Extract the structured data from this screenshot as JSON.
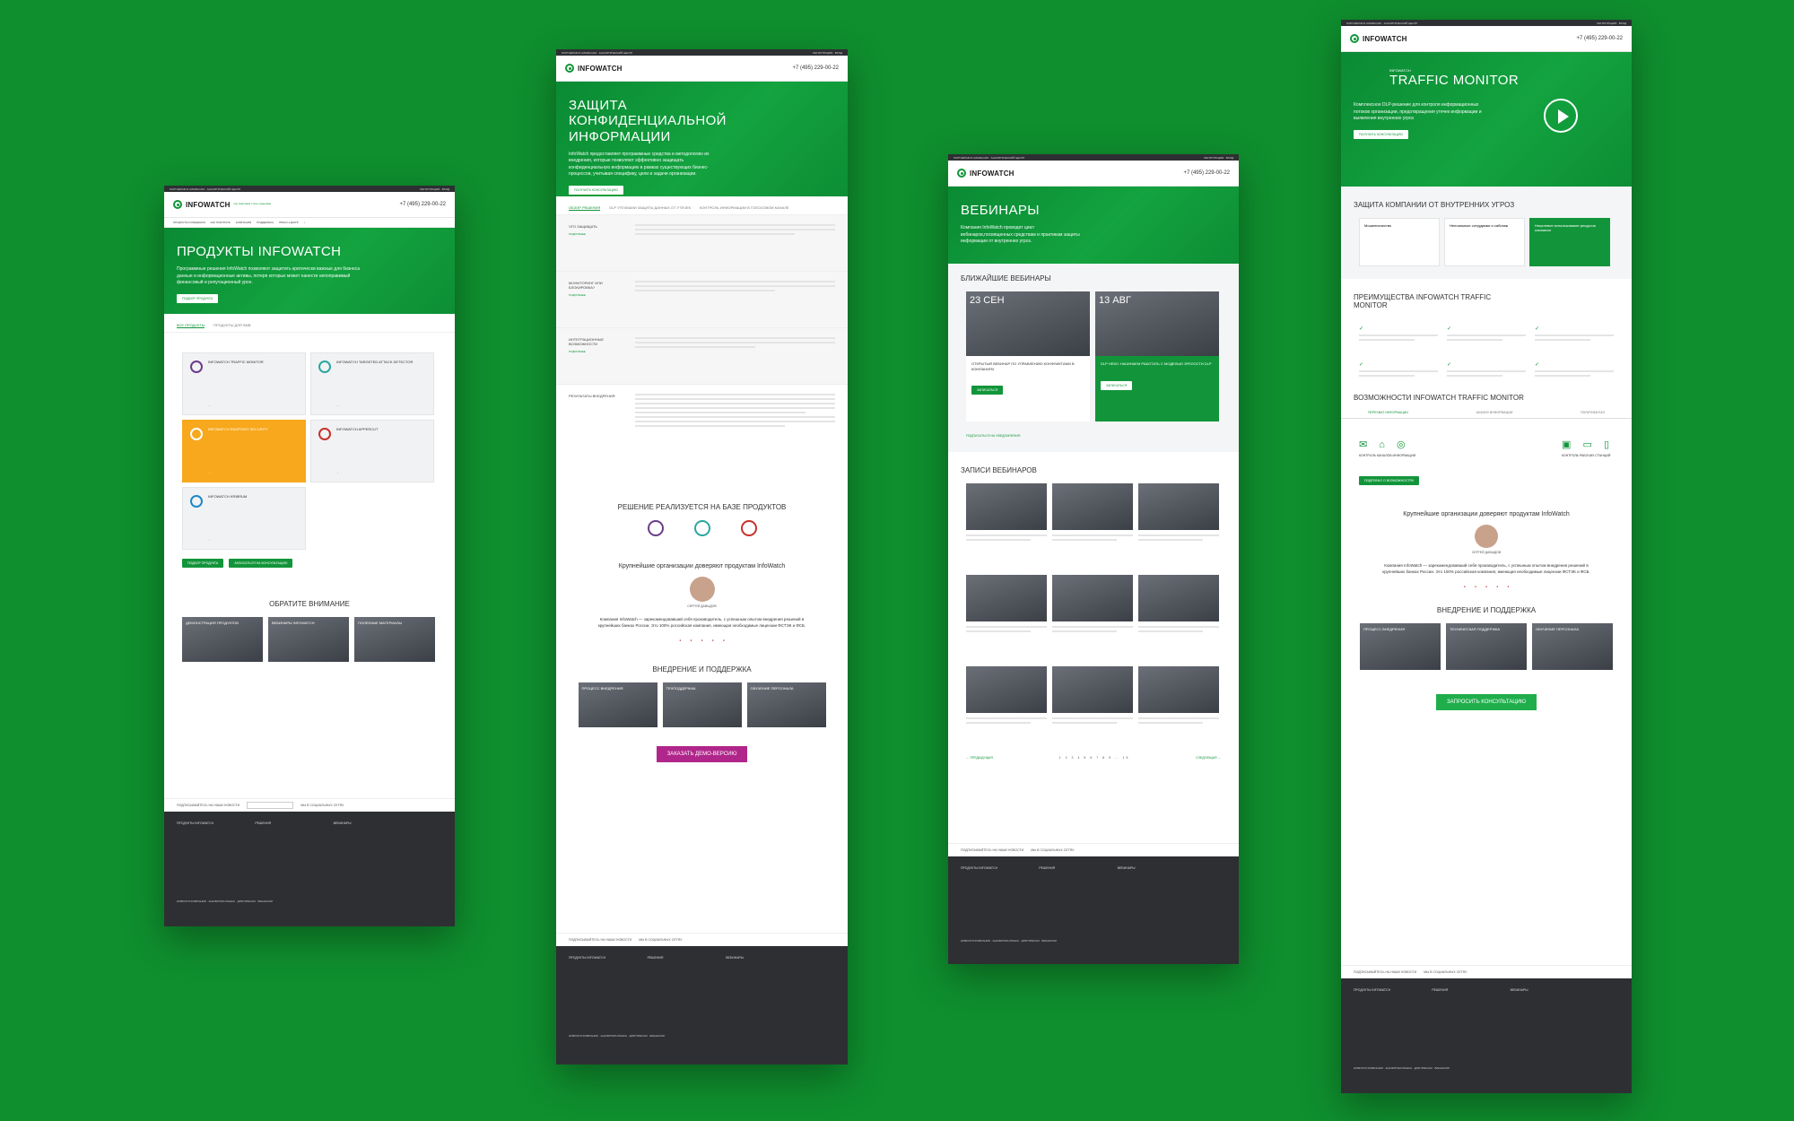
{
  "common": {
    "topbar_left": "ПАРТНЁРАМ И АЛЬЯНСАМ · АНАЛИТИЧЕСКИЙ ЦЕНТР",
    "topbar_right": "РЕГИСТРАЦИЯ · ВХОД",
    "logo": "INFOWATCH",
    "logo_tag": "мы помогаем стать лидерами",
    "phone": "+7 (495) 229-00-22",
    "nav": [
      "ПРОДУКТЫ И РЕШЕНИЯ",
      "КАК ПОКУПАТЬ",
      "КОМПАНИЯ",
      "ПОДДЕРЖКА",
      "ПРЕСС-ЦЕНТР",
      "УНИВЕРСИТЕТ INFOWATCH"
    ],
    "subscribe": "ПОДПИСЫВАЙТЕСЬ НА НАШИ НОВОСТИ",
    "social": "МЫ В СОЦИАЛЬНЫХ СЕТЯХ",
    "footer_cols": [
      "ПРОДУКТЫ INFOWATCH",
      "РЕШЕНИЯ",
      "ВЕБИНАРЫ"
    ],
    "footer_bottom": "НОВОСТИ КОМПАНИИ · АНАЛИТИКА РЫНКА · ДЛЯ ПРЕССЫ · ВАКАНСИИ"
  },
  "page1": {
    "title": "ПРОДУКТЫ INFOWATCH",
    "text": "Программные решения InfoWatch позволяют защитить критически важные для бизнеса данные и информационные активы, потеря которых может нанести непоправимый финансовый и репутационный урон.",
    "btn": "ПОДБОР ПРОДУКТА",
    "tabs": [
      "ВСЕ ПРОДУКТЫ",
      "ПРОДУКТЫ ДЛЯ SMB"
    ],
    "products": [
      {
        "title": "INFOWATCH TRAFFIC MONITOR"
      },
      {
        "title": "INFOWATCH TARGETED ATTACK DETECTOR"
      },
      {
        "title": "INFOWATCH ENDPOINT SECURITY"
      },
      {
        "title": "INFOWATCH APPERCUT"
      },
      {
        "title": "INFOWATCH KRIBRUM"
      }
    ],
    "btn_select": "ПОДБОР ПРОДУКТА",
    "btn_consult": "ЗАПИСАТЬСЯ НА КОНСУЛЬТАЦИЮ",
    "attention": "ОБРАТИТЕ ВНИМАНИЕ",
    "promo": [
      "ДЕМОНСТРАЦИЯ ПРОДУКТОВ",
      "ВЕБИНАРЫ INFOWATCH",
      "ПОЛЕЗНЫЕ МАТЕРИАЛЫ"
    ]
  },
  "page2": {
    "title": "ЗАЩИТА КОНФИДЕНЦИАЛЬНОЙ ИНФОРМАЦИИ",
    "text": "InfoWatch предоставляет программные средства и методологию их внедрения, которые позволяют эффективно защищать конфиденциальную информацию в рамках существующих бизнес-процессов, учитывая специфику, цели и задачи организации.",
    "btn": "ПОЛУЧИТЬ КОНСУЛЬТАЦИЮ",
    "tabs": [
      "ОБЗОР РЕШЕНИЯ",
      "DLP УТЕЧКАМИ ЗАЩИТЫ ДАННЫХ ОТ УТЕЧЕК",
      "КОНТРОЛЬ ИНФОРМАЦИИ В ГОЛОСОВОМ КАНАЛЕ"
    ],
    "rows": [
      "ЧТО ЗАЩИЩАТЬ",
      "МОНИТОРИНГ ИЛИ БЛОКИРОВКА?",
      "ИНТЕГРАЦИОННЫЕ ВОЗМОЖНОСТИ",
      "РЕЗУЛЬТАТЫ ВНЕДРЕНИЯ"
    ],
    "row_link": "ПОДРОБНЕЕ",
    "products_title": "РЕШЕНИЕ РЕАЛИЗУЕТСЯ НА БАЗЕ ПРОДУКТОВ",
    "trust": "Крупнейшие организации доверяют продуктам InfoWatch",
    "person": "СЕРГЕЙ ДАВЫДОВ",
    "quote": "Компания InfoWatch — зарекомендовавший себя производитель, с успешным опытом внедрения решений в крупнейших банках России. Это 100% российская компания, имеющая необходимые лицензии ФСТЭК и ФСБ.",
    "support": "ВНЕДРЕНИЕ И ПОДДЕРЖКА",
    "support_items": [
      "ПРОЦЕСС ВНЕДРЕНИЯ",
      "ТЕХПОДДЕРЖКА",
      "ОБУЧЕНИЕ ПЕРСОНАЛА"
    ],
    "cta": "ЗАКАЗАТЬ ДЕМО-ВЕРСИЮ"
  },
  "page3": {
    "title": "ВЕБИНАРЫ",
    "text": "Компания InfoWatch проводит цикл вебинаров,посвященных средствам и практикам защиты информации от внутренних угроз.",
    "upcoming": "БЛИЖАЙШИЕ ВЕБИНАРЫ",
    "events": [
      {
        "date": "23 СЕН",
        "title": "ОТКРЫТЫЙ ВЕБИНАР ПО УПРАВЛЕНИЮ КОНФЛИКТАМИ В КОМПАНИЯХ",
        "btn": "ЗАПИСАТЬСЯ"
      },
      {
        "date": "13 АВГ",
        "title": "DLP НЕ5О: НАЧИНАЕМ РАБОТАТЬ С МОДЕЛЬЮ ЗРЕЛОСТИ DLP",
        "btn": "ЗАПИСАТЬСЯ"
      }
    ],
    "subscribe_link": "ПОДПИСАТЬСЯ НА УВЕДОМЛЕНИЯ",
    "records": "ЗАПИСИ ВЕБИНАРОВ",
    "pager_prev": "← ПРЕДЫДУЩАЯ",
    "pager_next": "СЛЕДУЮЩАЯ →",
    "pages": [
      "1",
      "2",
      "3",
      "4",
      "5",
      "6",
      "7",
      "8",
      "9",
      "…",
      "15"
    ]
  },
  "page4": {
    "title": "TRAFFIC MONITOR",
    "subtitle": "INFOWATCH",
    "text": "Комплексное DLP-решение для контроля информационных потоков организации, предотвращения утечек информации и выявления внутренних угроз",
    "btn": "ПОЛУЧИТЬ КОНСУЛЬТАЦИЮ",
    "protect": "ЗАЩИТА КОМПАНИИ ОТ ВНУТРЕННИХ УГРОЗ",
    "threats": [
      "Мошенничество",
      "Нелояльные сотрудники и саботаж",
      "Нецелевое использование ресурсов компании"
    ],
    "advantages": "ПРЕИМУЩЕСТВА INFOWATCH TRAFFIC MONITOR",
    "capabilities": "ВОЗМОЖНОСТИ INFOWATCH TRAFFIC MONITOR",
    "cap_tabs": [
      "ПЕРЕХВАТ ИНФОРМАЦИИ",
      "АНАЛИЗ ИНФОРМАЦИИ",
      "ПОЛИТИКИ БЕЗ"
    ],
    "channels_left": "КОНТРОЛЬ КАНАЛОВ ИНФОРМАЦИИ",
    "channels_right": "КОНТРОЛЬ РАБОЧИХ СТАНЦИЙ",
    "btn_more": "ПОДРОБНО О ВОЗМОЖНОСТЯХ",
    "trust": "Крупнейшие организации доверяют продуктам InfoWatch",
    "person": "СЕРГЕЙ ДАВЫДОВ",
    "quote": "Компания InfoWatch — зарекомендовавший себя производитель, с успешным опытом внедрения решений в крупнейших банках России. Это 100% российская компания, имеющая необходимые лицензии ФСТЭК и ФСБ.",
    "support": "ВНЕДРЕНИЕ И ПОДДЕРЖКА",
    "support_items": [
      "ПРОЦЕСС ВНЕДРЕНИЯ",
      "ТЕХНИЧЕСКАЯ ПОДДЕРЖКА",
      "ОБУЧЕНИЕ ПЕРСОНАЛА"
    ],
    "cta": "ЗАПРОСИТЬ КОНСУЛЬТАЦИЮ"
  },
  "colors": {
    "background": "#0f8f2e",
    "brand": "#12953a",
    "dark": "#2e2f33",
    "orange": "#f7a81c",
    "purple": "#b0268b"
  }
}
